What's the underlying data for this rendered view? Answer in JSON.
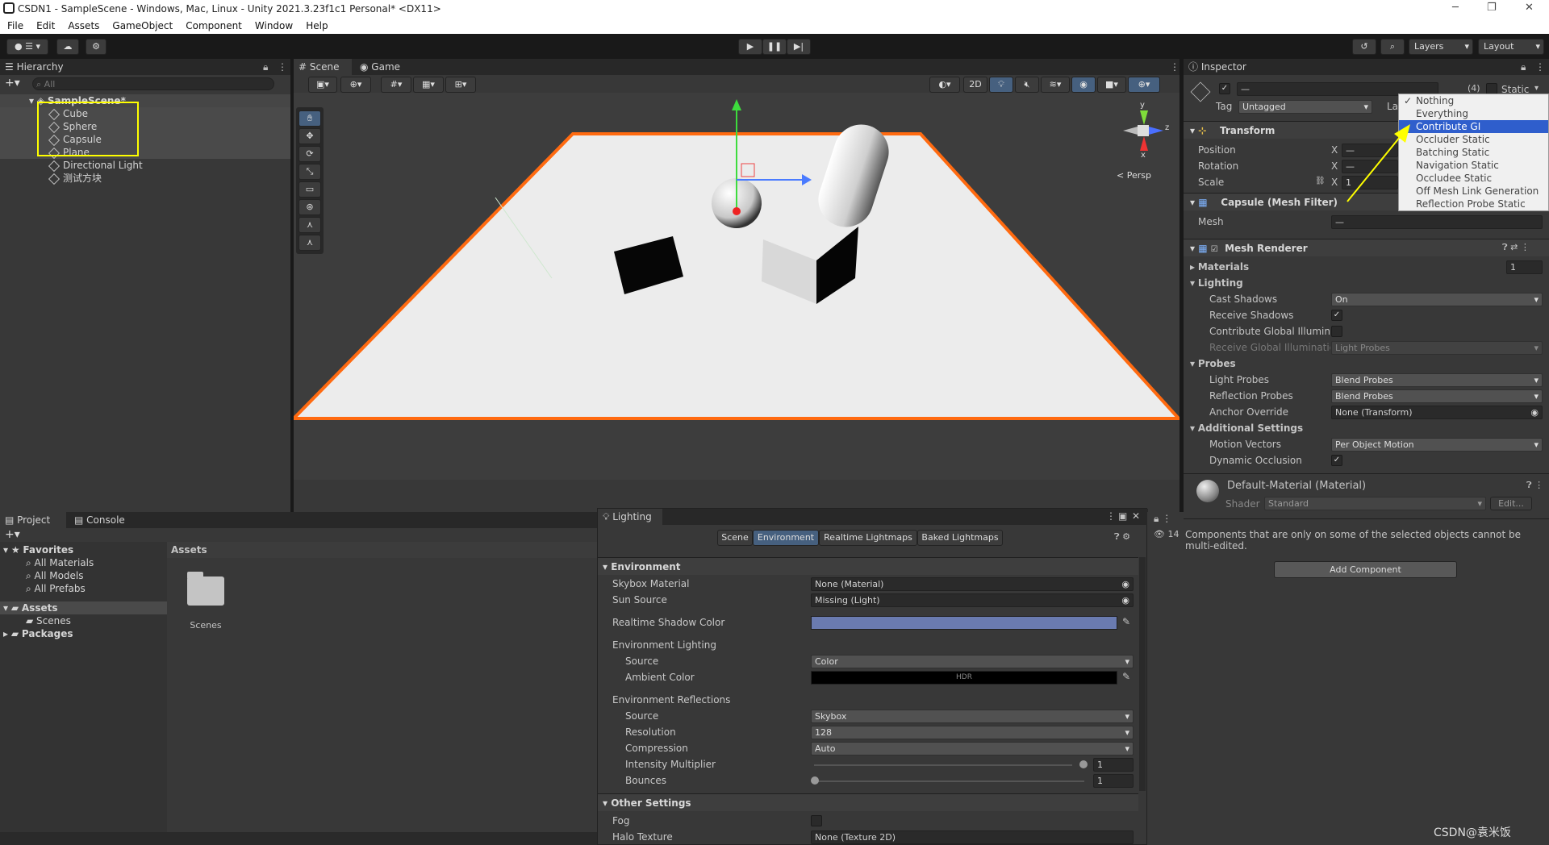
{
  "window": {
    "title": "CSDN1 - SampleScene - Windows, Mac, Linux - Unity 2021.3.23f1c1 Personal* <DX11>"
  },
  "menu": [
    "File",
    "Edit",
    "Assets",
    "GameObject",
    "Component",
    "Window",
    "Help"
  ],
  "toolbar": {
    "layers": "Layers",
    "layout": "Layout"
  },
  "hierarchy": {
    "tab": "Hierarchy",
    "search_placeholder": "All",
    "scene": "SampleScene*",
    "items": [
      "Cube",
      "Sphere",
      "Capsule",
      "Plane",
      "Directional Light",
      "测试方块"
    ]
  },
  "scene_view": {
    "tabs": [
      "Scene",
      "Game"
    ],
    "mode_2d": "2D",
    "persp": "< Persp",
    "axis_y": "y",
    "axis_z": "z",
    "axis_x": "x"
  },
  "inspector": {
    "tab": "Inspector",
    "name_field": "—",
    "count": "(4)",
    "static_label": "Static",
    "tag_label": "Tag",
    "tag_value": "Untagged",
    "layer_label": "La",
    "transform": {
      "title": "Transform",
      "position": "Position",
      "rotation": "Rotation",
      "scale": "Scale",
      "x": "X",
      "pos_x": "—",
      "rot_x": "—",
      "scale_x": "1"
    },
    "mesh_filter": {
      "title": "Capsule (Mesh Filter)",
      "mesh_label": "Mesh",
      "mesh_value": "—"
    },
    "mesh_renderer": {
      "title": "Mesh Renderer",
      "materials": "Materials",
      "materials_count": "1",
      "lighting": "Lighting",
      "cast_shadows": "Cast Shadows",
      "cast_shadows_value": "On",
      "receive_shadows": "Receive Shadows",
      "contribute_gi": "Contribute Global Illuminat",
      "receive_gi": "Receive Global Illuminatior",
      "receive_gi_value": "Light Probes",
      "probes": "Probes",
      "light_probes": "Light Probes",
      "light_probes_value": "Blend Probes",
      "reflection_probes": "Reflection Probes",
      "reflection_probes_value": "Blend Probes",
      "anchor_override": "Anchor Override",
      "anchor_override_value": "None (Transform)",
      "additional": "Additional Settings",
      "motion_vectors": "Motion Vectors",
      "motion_vectors_value": "Per Object Motion",
      "dynamic_occlusion": "Dynamic Occlusion"
    },
    "material": {
      "title": "Default-Material (Material)",
      "shader_label": "Shader",
      "shader_value": "Standard",
      "edit": "Edit..."
    },
    "note": "Components that are only on some of the selected objects cannot be multi-edited.",
    "add_component": "Add Component"
  },
  "static_dropdown": {
    "options": [
      "Nothing",
      "Everything",
      "Contribute GI",
      "Occluder Static",
      "Batching Static",
      "Navigation Static",
      "Occludee Static",
      "Off Mesh Link Generation",
      "Reflection Probe Static"
    ],
    "checked": "Nothing",
    "highlighted": "Contribute GI"
  },
  "project": {
    "tabs": [
      "Project",
      "Console"
    ],
    "favorites": "Favorites",
    "fav_items": [
      "All Materials",
      "All Models",
      "All Prefabs"
    ],
    "assets": "Assets",
    "assets_children": [
      "Scenes"
    ],
    "packages": "Packages",
    "breadcrumb": "Assets",
    "folder": "Scenes"
  },
  "lighting": {
    "tab": "Lighting",
    "tabs": [
      "Scene",
      "Environment",
      "Realtime Lightmaps",
      "Baked Lightmaps"
    ],
    "active_tab": "Environment",
    "environment": "Environment",
    "skybox_material": "Skybox Material",
    "skybox_value": "None (Material)",
    "sun_source": "Sun Source",
    "sun_value": "Missing (Light)",
    "shadow_color": "Realtime Shadow Color",
    "env_lighting": "Environment Lighting",
    "source": "Source",
    "source_value": "Color",
    "ambient_color": "Ambient Color",
    "hdr": "HDR",
    "env_reflections": "Environment Reflections",
    "refl_source_value": "Skybox",
    "resolution": "Resolution",
    "resolution_value": "128",
    "compression": "Compression",
    "compression_value": "Auto",
    "intensity": "Intensity Multiplier",
    "intensity_value": "1",
    "bounces": "Bounces",
    "bounces_value": "1",
    "other": "Other Settings",
    "fog": "Fog",
    "halo": "Halo Texture",
    "halo_value": "None (Texture 2D)",
    "hidden_count": "14"
  },
  "watermark": "CSDN@袁米饭",
  "colors": {
    "selection": "#2f5ecc",
    "plane_outline": "#ff6a10",
    "highlight_box": "#ffff00",
    "shadow_color": "#6a7bb0"
  }
}
